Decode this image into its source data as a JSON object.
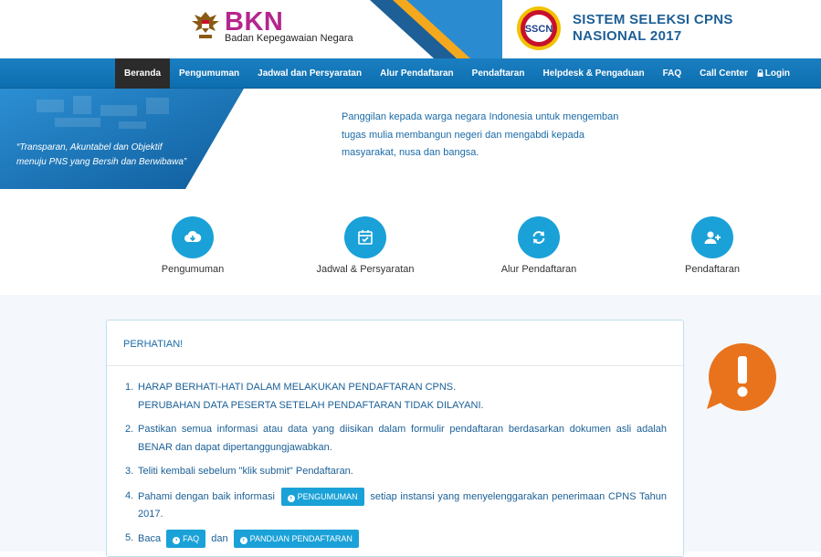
{
  "header": {
    "bkn_title": "BKN",
    "bkn_subtitle": "Badan Kepegawaian Negara",
    "sscn_title_line1": "SISTEM SELEKSI CPNS",
    "sscn_title_line2": "NASIONAL 2017",
    "sscn_badge": "SSCN"
  },
  "nav": {
    "items": [
      {
        "label": "Beranda"
      },
      {
        "label": "Pengumuman"
      },
      {
        "label": "Jadwal dan Persyaratan"
      },
      {
        "label": "Alur Pendaftaran"
      },
      {
        "label": "Pendaftaran"
      },
      {
        "label": "Helpdesk & Pengaduan"
      },
      {
        "label": "FAQ"
      },
      {
        "label": "Call Center"
      }
    ],
    "login": "Login"
  },
  "banner": {
    "quote_line1": "“Transparan, Akuntabel dan Objektif",
    "quote_line2": "menuju PNS yang Bersih dan Berwibawa”",
    "text_line1": "Panggilan kepada warga negara Indonesia untuk mengemban",
    "text_line2": "tugas mulia membangun negeri dan mengabdi kepada",
    "text_line3": "masyarakat, nusa dan bangsa."
  },
  "features": [
    {
      "label": "Pengumuman",
      "icon": "cloud-download-icon"
    },
    {
      "label": "Jadwal & Persyaratan",
      "icon": "calendar-check-icon"
    },
    {
      "label": "Alur Pendaftaran",
      "icon": "refresh-icon"
    },
    {
      "label": "Pendaftaran",
      "icon": "user-plus-icon"
    }
  ],
  "notice": {
    "title": "PERHATIAN!",
    "item1_num": "1.",
    "item1_line1": "HARAP BERHATI-HATI DALAM MELAKUKAN PENDAFTARAN CPNS.",
    "item1_line2": "PERUBAHAN DATA PESERTA SETELAH PENDAFTARAN TIDAK DILAYANI.",
    "item2_num": "2.",
    "item2_text": "Pastikan semua informasi atau data yang diisikan dalam formulir pendaftaran berdasarkan dokumen asli adalah BENAR dan dapat dipertanggungjawabkan.",
    "item3_num": "3.",
    "item3_text": "Teliti kembali sebelum \"klik submit\" Pendaftaran.",
    "item4_num": "4.",
    "item4_before": "Pahami dengan baik informasi",
    "item4_button": "PENGUMUMAN",
    "item4_after": "setiap instansi yang menyelenggarakan penerimaan CPNS Tahun 2017.",
    "item5_num": "5.",
    "item5_before": "Baca",
    "item5_button1": "FAQ",
    "item5_mid": "dan",
    "item5_button2": "PANDUAN PENDAFTARAN"
  },
  "colors": {
    "nav_blue": "#1a7fc2",
    "accent": "#1aa1d8",
    "alert_orange": "#e8731c",
    "bkn_magenta": "#b5268d"
  }
}
